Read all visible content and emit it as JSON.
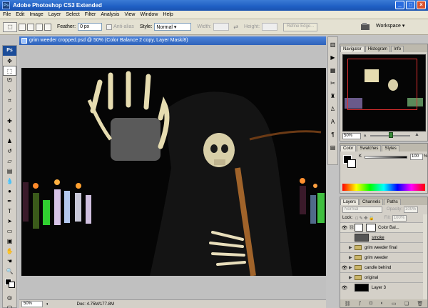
{
  "app": {
    "title": "Adobe Photoshop CS3 Extended",
    "logo": "Ps"
  },
  "menu": [
    "File",
    "Edit",
    "Image",
    "Layer",
    "Select",
    "Filter",
    "Analysis",
    "View",
    "Window",
    "Help"
  ],
  "options": {
    "feather_label": "Feather:",
    "feather_value": "0 px",
    "antialias_label": "Anti-alias",
    "style_label": "Style:",
    "style_value": "Normal",
    "width_label": "Width:",
    "height_label": "Height:",
    "refine_label": "Refine Edge...",
    "workspace_label": "Workspace"
  },
  "document": {
    "title": "grim weeder cropped.psd @ 50% (Color Balance 2 copy, Layer Mask/8)",
    "zoom": "50%",
    "doc_size": "Doc: 4.75M/177.8M"
  },
  "panels": {
    "nav_tabs": [
      "Navigator",
      "Histogram",
      "Info"
    ],
    "nav_zoom": "50%",
    "color_tabs": [
      "Color",
      "Swatches",
      "Styles"
    ],
    "k_label": "K",
    "k_value": "100",
    "k_unit": "%",
    "layer_tabs": [
      "Layers",
      "Channels",
      "Paths"
    ],
    "blend_mode": "Normal",
    "opacity_label": "Opacity:",
    "opacity_value": "100%",
    "lock_label": "Lock:",
    "fill_label": "Fill:",
    "fill_value": "100%",
    "layers": [
      {
        "name": "Color Bal...",
        "type": "adjustment",
        "eye": true
      },
      {
        "name": "smoke",
        "type": "pixel",
        "eye": false
      },
      {
        "name": "grim weeder final",
        "type": "group",
        "eye": false
      },
      {
        "name": "grim weeder",
        "type": "group",
        "eye": false
      },
      {
        "name": "candle behind",
        "type": "group",
        "eye": true
      },
      {
        "name": "original",
        "type": "group",
        "eye": false
      },
      {
        "name": "Layer 3",
        "type": "pixel",
        "eye": true
      }
    ]
  },
  "colors": {
    "title_blue": "#2a68cc",
    "accent_red": "#e03030"
  }
}
